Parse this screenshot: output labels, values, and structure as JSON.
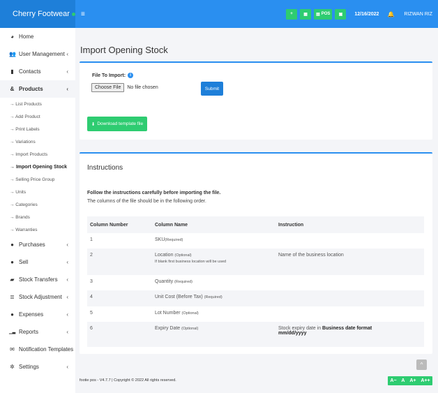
{
  "brand": {
    "name": "Cherry Footwear"
  },
  "topbar": {
    "menu_icon": "≡",
    "buttons": [
      {
        "icon": "plus-circle-icon",
        "glyph": "+",
        "label": ""
      },
      {
        "icon": "calculator-icon",
        "glyph": "▦",
        "label": ""
      },
      {
        "icon": "pos-icon",
        "glyph": "▤",
        "label": "POS"
      },
      {
        "icon": "money-icon",
        "glyph": "▣",
        "label": ""
      }
    ],
    "date": "12/16/2022",
    "user": "RIZWAN RIZ",
    "accent": "#2a8ff0",
    "green": "#2ecc71"
  },
  "sidebar": {
    "items": [
      {
        "label": "Home",
        "icon": "dashboard-icon",
        "glyph": "◕"
      },
      {
        "label": "User Management",
        "icon": "users-icon",
        "glyph": "👥",
        "chev": "‹"
      },
      {
        "label": "Contacts",
        "icon": "address-book-icon",
        "glyph": "▮",
        "chev": "‹"
      },
      {
        "label": "Products",
        "icon": "cubes-icon",
        "glyph": "&",
        "chev": "‹"
      }
    ],
    "products_sub": [
      "→ List Products",
      "→ Add Product",
      "→ Print Labels",
      "→ Variations",
      "→ Import Products",
      "→ Import Opening Stock",
      "→ Selling Price Group",
      "→ Units",
      "→ Categories",
      "→ Brands",
      "→ Warranties"
    ],
    "items_after": [
      {
        "label": "Purchases",
        "icon": "arrow-circle-down-icon",
        "glyph": "●",
        "chev": "‹"
      },
      {
        "label": "Sell",
        "icon": "arrow-circle-up-icon",
        "glyph": "●",
        "chev": "‹"
      },
      {
        "label": "Stock Transfers",
        "icon": "truck-icon",
        "glyph": "▰",
        "chev": "‹"
      },
      {
        "label": "Stock Adjustment",
        "icon": "database-icon",
        "glyph": "≣",
        "chev": "‹"
      },
      {
        "label": "Expenses",
        "icon": "minus-circle-icon",
        "glyph": "●",
        "chev": "‹"
      },
      {
        "label": "Reports",
        "icon": "chart-icon",
        "glyph": "▁▃",
        "chev": "‹"
      },
      {
        "label": "Notification Templates",
        "icon": "envelope-icon",
        "glyph": "✉"
      },
      {
        "label": "Settings",
        "icon": "cog-icon",
        "glyph": "✲",
        "chev": "‹"
      }
    ]
  },
  "page": {
    "title": "Import Opening Stock"
  },
  "import_form": {
    "file_label": "File To Import:",
    "info_glyph": "i",
    "choose_file": "Choose File",
    "no_file": "No file chosen",
    "submit": "Submit",
    "download": "Download template file",
    "download_glyph": "⬇"
  },
  "instructions": {
    "title": "Instructions",
    "bold_line": "Follow the instructions carefully before importing the file.",
    "line2": "The columns of the file should be in the following order.",
    "headers": [
      "Column Number",
      "Column Name",
      "Instruction"
    ],
    "rows": [
      {
        "num": "1",
        "name": "SKU",
        "req": "(Required)",
        "note": "",
        "instr": "",
        "instr_bold": "",
        "instr_tail": ""
      },
      {
        "num": "2",
        "name": "Location",
        "req": "(Optional)",
        "note": "If blank first business location will be used",
        "instr": "Name of the business location",
        "instr_bold": "",
        "instr_tail": ""
      },
      {
        "num": "3",
        "name": "Quantity",
        "req": "(Required)",
        "note": "",
        "instr": "",
        "instr_bold": "",
        "instr_tail": ""
      },
      {
        "num": "4",
        "name": "Unit Cost (Before Tax)",
        "req": "(Required)",
        "note": "",
        "instr": "",
        "instr_bold": "",
        "instr_tail": ""
      },
      {
        "num": "5",
        "name": "Lot Number",
        "req": "(Optional)",
        "note": "",
        "instr": "",
        "instr_bold": "",
        "instr_tail": ""
      },
      {
        "num": "6",
        "name": "Expiry Date",
        "req": "(Optional)",
        "note": "",
        "instr": "Stock expiry date in ",
        "instr_bold": "Business date format",
        "instr_tail": "mm/dd/yyyy"
      }
    ]
  },
  "footer": {
    "text": "footie pos - V4.7.7 | Copyright © 2022 All rights reserved.",
    "scroll_glyph": "^",
    "font_sizes": [
      "A−",
      "A",
      "A+",
      "A++"
    ]
  }
}
